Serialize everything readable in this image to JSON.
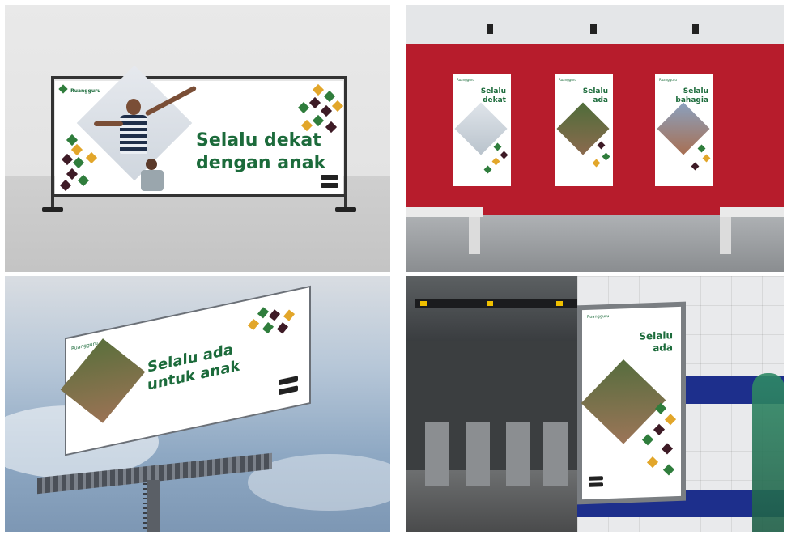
{
  "panels": {
    "banner": {
      "logo": "Ruangguru",
      "headline_line1": "Selalu dekat",
      "headline_line2": "dengan anak"
    },
    "wall": {
      "posters": [
        {
          "logo": "Ruangguru",
          "line1": "Selalu",
          "line2": "dekat"
        },
        {
          "logo": "Ruangguru",
          "line1": "Selalu",
          "line2": "ada"
        },
        {
          "logo": "Ruangguru",
          "line1": "Selalu",
          "line2": "bahagia"
        }
      ]
    },
    "billboard": {
      "logo": "Ruangguru",
      "headline_line1": "Selalu ada",
      "headline_line2": "untuk anak"
    },
    "subway": {
      "logo": "Ruangguru",
      "line1": "Selalu",
      "line2": "ada"
    }
  },
  "colors": {
    "brand_green": "#1c6b3b",
    "accent_yellow": "#e2a62a",
    "accent_dark": "#3e1b26",
    "wall_red": "#b71c2c"
  }
}
